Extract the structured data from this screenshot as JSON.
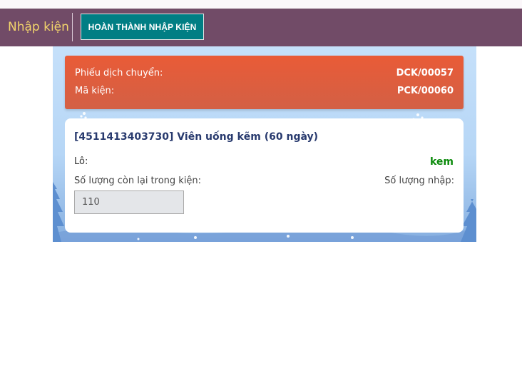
{
  "navbar": {
    "title": "Nhập kiện",
    "done_button": "HOÀN THÀNH NHẬP KIỆN"
  },
  "transfer": {
    "label": "Phiếu dịch chuyển:",
    "value": "DCK/00057"
  },
  "package": {
    "label": "Mã kiện:",
    "value": "PCK/00060"
  },
  "product": {
    "title": "[4511413403730] Viên uống kẽm (60 ngày)",
    "lot_label": "Lô:",
    "lot_value": "kem",
    "remaining_label": "Số lượng còn lại trong kiện:",
    "remaining_value": "110",
    "import_label": "Số lượng nhập:"
  },
  "colors": {
    "navbar": "#714b67",
    "brand": "#f2d46b",
    "button": "#017e84",
    "info_card": "#e95b37",
    "title_text": "#283a6e",
    "lot_text": "#0a8a0a"
  }
}
